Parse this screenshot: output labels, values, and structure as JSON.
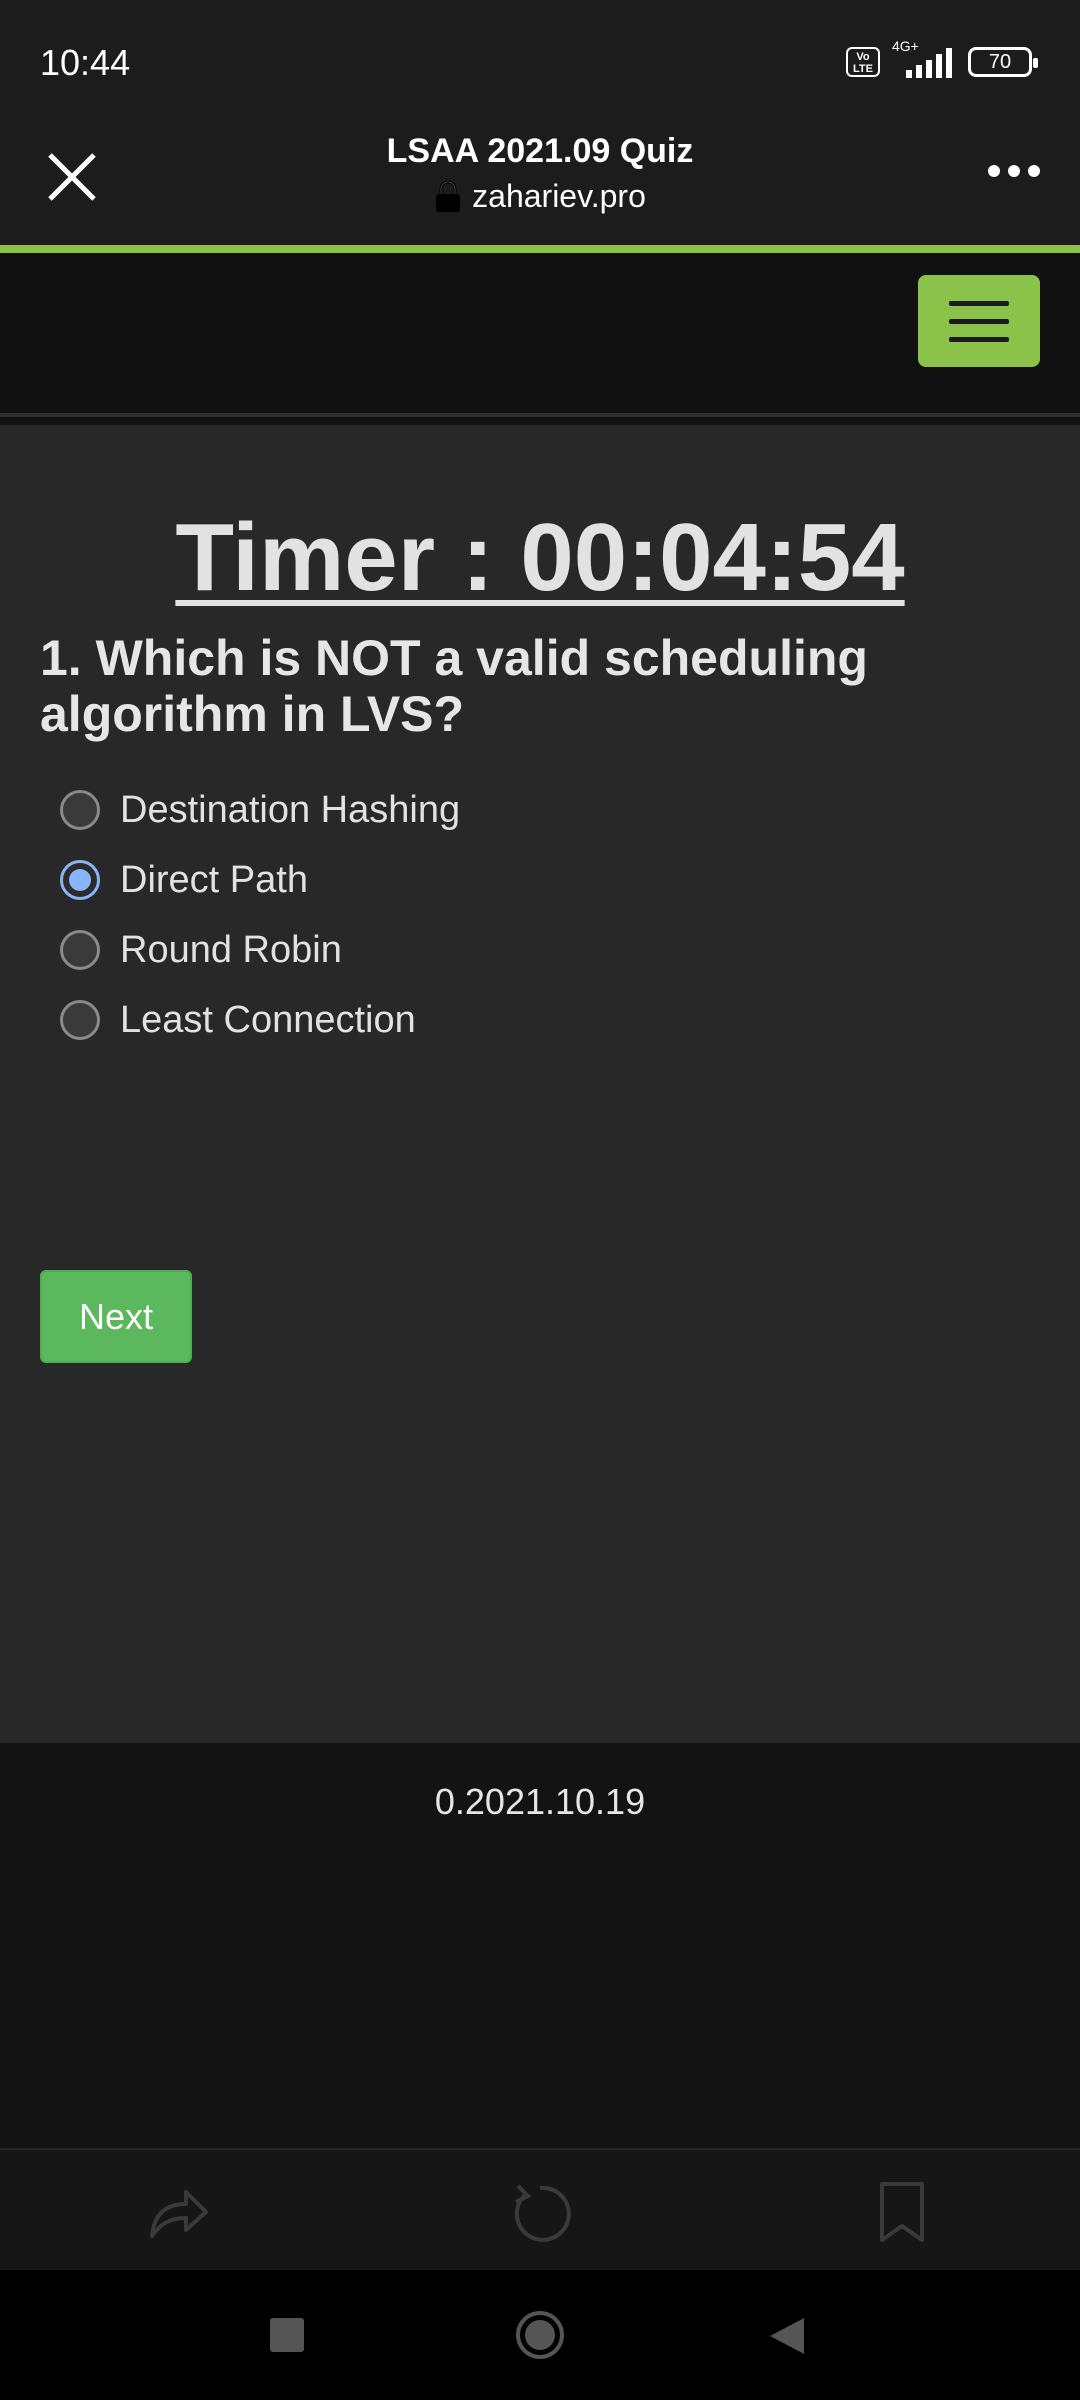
{
  "status_bar": {
    "time": "10:44",
    "volte": "Vo LTE",
    "network": "4G+",
    "battery": "70"
  },
  "browser": {
    "page_title": "LSAA 2021.09 Quiz",
    "url": "zahariev.pro",
    "progress_color": "#8bc34a"
  },
  "header": {
    "menu_icon": "hamburger-icon",
    "accent": "#8bc34a"
  },
  "quiz": {
    "timer": "Timer : 00:04:54",
    "question": "1. Which is NOT a valid scheduling algorithm in LVS?",
    "options": [
      {
        "label": "Destination Hashing",
        "selected": false
      },
      {
        "label": "Direct Path",
        "selected": true
      },
      {
        "label": "Round Robin",
        "selected": false
      },
      {
        "label": "Least Connection",
        "selected": false
      }
    ],
    "next_label": "Next"
  },
  "footer": {
    "version": "0.2021.10.19"
  },
  "toolbar": {
    "icons": [
      "share-icon",
      "reload-icon",
      "bookmark-icon"
    ]
  },
  "nav": {
    "icons": [
      "recents-icon",
      "home-icon",
      "back-icon"
    ]
  }
}
